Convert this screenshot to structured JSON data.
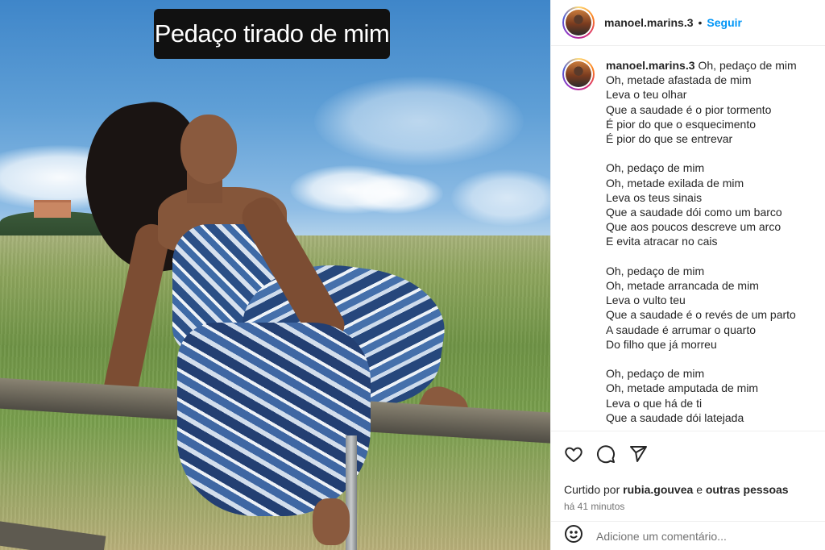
{
  "media": {
    "overlay_text": "Pedaço tirado de mim"
  },
  "post": {
    "username": "manoel.marins.3",
    "separator": "•",
    "follow_label": "Seguir"
  },
  "caption": {
    "author": "manoel.marins.3",
    "stanzas": [
      [
        "Oh, pedaço de mim",
        "Oh, metade afastada de mim",
        "Leva o teu olhar",
        "Que a saudade é o pior tormento",
        "É pior do que o esquecimento",
        "É pior do que se entrevar"
      ],
      [
        "Oh, pedaço de mim",
        "Oh, metade exilada de mim",
        "Leva os teus sinais",
        "Que a saudade dói como um barco",
        "Que aos poucos descreve um arco",
        "E evita atracar no cais"
      ],
      [
        "Oh, pedaço de mim",
        "Oh, metade arrancada de mim",
        "Leva o vulto teu",
        "Que a saudade é o revés de um parto",
        "A saudade é arrumar o quarto",
        "Do filho que já morreu"
      ],
      [
        "Oh, pedaço de mim",
        "Oh, metade amputada de mim",
        "Leva o que há de ti",
        "Que a saudade dói latejada"
      ]
    ]
  },
  "actions": {
    "icons": [
      "heart-icon",
      "comment-icon",
      "share-icon"
    ]
  },
  "likes": {
    "prefix": "Curtido por",
    "user": "rubia.gouvea",
    "connector": "e",
    "others": "outras pessoas"
  },
  "time": "há 41 minutos",
  "add_comment": {
    "placeholder": "Adicione um comentário..."
  }
}
